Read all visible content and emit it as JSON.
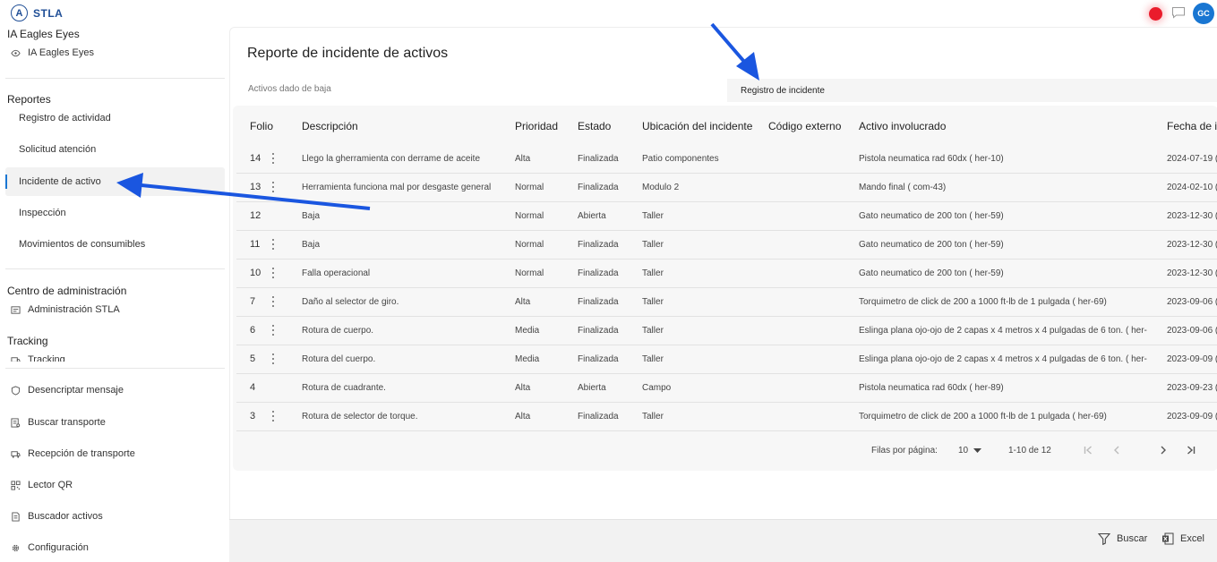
{
  "app": {
    "name": "STLA",
    "user_initials": "GC"
  },
  "sidebar": {
    "section_ia": {
      "title": "IA Eagles Eyes",
      "item": "IA Eagles Eyes"
    },
    "section_reportes": {
      "title": "Reportes",
      "items": [
        "Registro de actividad",
        "Solicitud atención",
        "Incidente de activo",
        "Inspección",
        "Movimientos de consumibles"
      ],
      "active_index": 2
    },
    "section_admin": {
      "title": "Centro de administración",
      "item": "Administración STLA"
    },
    "section_tracking": {
      "title": "Tracking",
      "item": "Tracking"
    },
    "tools": [
      {
        "label": "Desencriptar mensaje",
        "icon": "shield-icon"
      },
      {
        "label": "Buscar transporte",
        "icon": "list-search-icon"
      },
      {
        "label": "Recepción de transporte",
        "icon": "truck-icon"
      },
      {
        "label": "Lector QR",
        "icon": "qr-icon"
      },
      {
        "label": "Buscador activos",
        "icon": "document-search-icon"
      },
      {
        "label": "Configuración",
        "icon": "gear-icon"
      }
    ]
  },
  "main": {
    "title": "Reporte de incidente de activos",
    "tabs": {
      "left": "Activos dado de baja",
      "right": "Registro de incidente"
    },
    "table": {
      "headers": [
        "Folio",
        "Descripción",
        "Prioridad",
        "Estado",
        "Ubicación del incidente",
        "Código externo",
        "Activo involucrado",
        "Fecha de i"
      ],
      "rows": [
        {
          "folio": "14",
          "menu": true,
          "descripcion": "Llego la gherramienta con derrame de aceite",
          "prioridad": "Alta",
          "estado": "Finalizada",
          "ubicacion": "Patio componentes",
          "codigo": "",
          "activo": "Pistola neumatica rad 60dx ( her-10)",
          "fecha": "2024-07-19 ("
        },
        {
          "folio": "13",
          "menu": true,
          "descripcion": "Herramienta funciona mal por desgaste general",
          "prioridad": "Normal",
          "estado": "Finalizada",
          "ubicacion": "Modulo 2",
          "codigo": "",
          "activo": "Mando final ( com-43)",
          "fecha": "2024-02-10 ("
        },
        {
          "folio": "12",
          "menu": false,
          "descripcion": "Baja",
          "prioridad": "Normal",
          "estado": "Abierta",
          "ubicacion": "Taller",
          "codigo": "",
          "activo": "Gato neumatico de 200 ton ( her-59)",
          "fecha": "2023-12-30 ("
        },
        {
          "folio": "11",
          "menu": true,
          "descripcion": "Baja",
          "prioridad": "Normal",
          "estado": "Finalizada",
          "ubicacion": "Taller",
          "codigo": "",
          "activo": "Gato neumatico de 200 ton ( her-59)",
          "fecha": "2023-12-30 ("
        },
        {
          "folio": "10",
          "menu": true,
          "descripcion": "Falla operacional",
          "prioridad": "Normal",
          "estado": "Finalizada",
          "ubicacion": "Taller",
          "codigo": "",
          "activo": "Gato neumatico de 200 ton ( her-59)",
          "fecha": "2023-12-30 ("
        },
        {
          "folio": "7",
          "menu": true,
          "descripcion": "Daño al selector de giro.",
          "prioridad": "Alta",
          "estado": "Finalizada",
          "ubicacion": "Taller",
          "codigo": "",
          "activo": "Torquimetro de click de 200 a 1000 ft-lb de 1 pulgada ( her-69)",
          "fecha": "2023-09-06 ("
        },
        {
          "folio": "6",
          "menu": true,
          "descripcion": "Rotura de cuerpo.",
          "prioridad": "Media",
          "estado": "Finalizada",
          "ubicacion": "Taller",
          "codigo": "",
          "activo": "Eslinga plana ojo-ojo de 2 capas x 4 metros x 4 pulgadas de 6 ton. ( her-",
          "fecha": "2023-09-06 ("
        },
        {
          "folio": "5",
          "menu": true,
          "descripcion": "Rotura del cuerpo.",
          "prioridad": "Media",
          "estado": "Finalizada",
          "ubicacion": "Taller",
          "codigo": "",
          "activo": "Eslinga plana ojo-ojo de 2 capas x 4 metros x 4 pulgadas de 6 ton. ( her-",
          "fecha": "2023-09-09 ("
        },
        {
          "folio": "4",
          "menu": false,
          "descripcion": "Rotura de cuadrante.",
          "prioridad": "Alta",
          "estado": "Abierta",
          "ubicacion": "Campo",
          "codigo": "",
          "activo": "Pistola neumatica rad 60dx ( her-89)",
          "fecha": "2023-09-23 ("
        },
        {
          "folio": "3",
          "menu": true,
          "descripcion": "Rotura de selector de torque.",
          "prioridad": "Alta",
          "estado": "Finalizada",
          "ubicacion": "Taller",
          "codigo": "",
          "activo": "Torquimetro de click de 200 a 1000 ft-lb de 1 pulgada ( her-69)",
          "fecha": "2023-09-09 ("
        }
      ]
    },
    "pagination": {
      "rows_label": "Filas por página:",
      "rows_value": "10",
      "range": "1-10 de 12"
    }
  },
  "bottom": {
    "search_label": "Buscar",
    "excel_label": "Excel"
  },
  "colors": {
    "accent": "#1976d2",
    "brand": "#1f4e96",
    "record": "#ea1c2c",
    "annotation_arrow": "#1a56e0"
  }
}
